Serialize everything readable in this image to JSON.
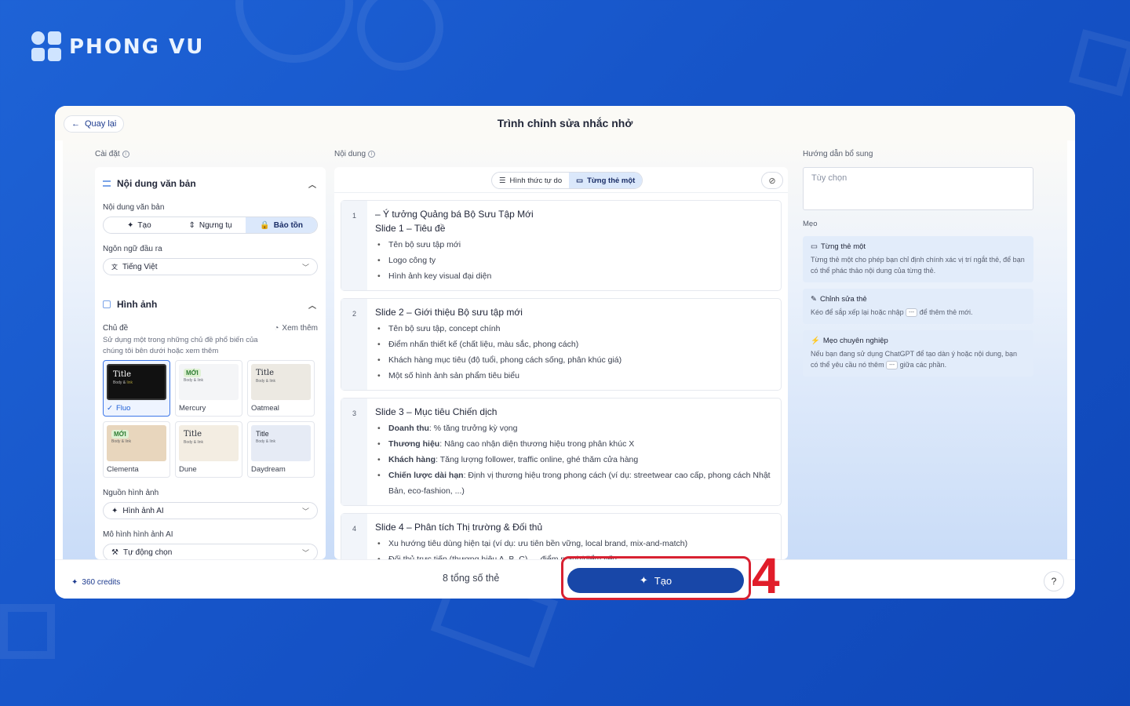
{
  "brand": {
    "name": "PHONG VU"
  },
  "window": {
    "back_label": "Quay lại",
    "title": "Trình chỉnh sửa nhắc nhở"
  },
  "settings": {
    "label": "Cài đặt",
    "text_section": {
      "title": "Nội dung văn bản",
      "content_label": "Nội dung văn bản",
      "modes": [
        "Tạo",
        "Ngưng tụ",
        "Bảo tồn"
      ],
      "active_mode": "Bảo tồn",
      "lang_label": "Ngôn ngữ đầu ra",
      "lang_value": "Tiếng Việt"
    },
    "image_section": {
      "title": "Hình ảnh",
      "theme_label": "Chủ đề",
      "theme_desc": "Sử dụng một trong những chủ đề phổ biến của chúng tôi bên dưới hoặc xem thêm",
      "see_more": "Xem thêm",
      "themes": [
        {
          "name": "Fluo",
          "preview_title": "Title",
          "selected": true,
          "badge": ""
        },
        {
          "name": "Mercury",
          "preview_title": "",
          "selected": false,
          "badge": "MỚI"
        },
        {
          "name": "Oatmeal",
          "preview_title": "Title",
          "selected": false,
          "badge": ""
        },
        {
          "name": "Clementa",
          "preview_title": "",
          "selected": false,
          "badge": "MỚI"
        },
        {
          "name": "Dune",
          "preview_title": "Title",
          "selected": false,
          "badge": ""
        },
        {
          "name": "Daydream",
          "preview_title": "Title",
          "selected": false,
          "badge": ""
        }
      ],
      "source_label": "Nguồn hình ảnh",
      "source_value": "Hình ảnh AI",
      "model_label": "Mô hình hình ảnh AI",
      "model_value": "Tự động chọn"
    }
  },
  "content": {
    "label": "Nội dung",
    "view_free": "Hình thức tự do",
    "view_card": "Từng thẻ một",
    "slides": [
      {
        "num": "1",
        "pre": "– Ý tưởng Quảng bá Bộ Sưu Tập Mới",
        "title": "Slide 1 – Tiêu đề",
        "items": [
          {
            "b": "",
            "t": "Tên bộ sưu tập mới"
          },
          {
            "b": "",
            "t": "Logo công ty"
          },
          {
            "b": "",
            "t": "Hình ảnh key visual đại diện"
          }
        ]
      },
      {
        "num": "2",
        "pre": "",
        "title": "Slide 2 – Giới thiệu Bộ sưu tập mới",
        "items": [
          {
            "b": "",
            "t": "Tên bộ sưu tập, concept chính"
          },
          {
            "b": "",
            "t": "Điểm nhấn thiết kế (chất liệu, màu sắc, phong cách)"
          },
          {
            "b": "",
            "t": "Khách hàng mục tiêu (độ tuổi, phong cách sống, phân khúc giá)"
          },
          {
            "b": "",
            "t": "Một số hình ảnh sản phẩm tiêu biểu"
          }
        ]
      },
      {
        "num": "3",
        "pre": "",
        "title": "Slide 3 – Mục tiêu Chiến dịch",
        "items": [
          {
            "b": "Doanh thu",
            "t": ": % tăng trưởng kỳ vọng"
          },
          {
            "b": "Thương hiệu",
            "t": ": Nâng cao nhận diện thương hiệu trong phân khúc X"
          },
          {
            "b": "Khách hàng",
            "t": ": Tăng lượng follower, traffic online, ghé thăm cửa hàng"
          },
          {
            "b": "Chiến lược dài hạn",
            "t": ": Định vị thương hiệu trong phong cách (ví dụ: streetwear cao cấp, phong cách Nhật Bản, eco-fashion, ...)"
          }
        ]
      },
      {
        "num": "4",
        "pre": "",
        "title": "Slide 4 – Phân tích Thị trường & Đối thủ",
        "items": [
          {
            "b": "",
            "t": "Xu hướng tiêu dùng hiện tại (ví dụ: ưu tiên bền vững, local brand, mix-and-match)"
          },
          {
            "b": "",
            "t": "Đối thủ trực tiếp (thương hiệu A, B, C) → điểm mạnh/điểm yếu"
          }
        ]
      }
    ]
  },
  "extra": {
    "label": "Hướng dẫn bổ sung",
    "placeholder": "Tùy chọn",
    "tips_label": "Mẹo",
    "tips": [
      {
        "title": "Từng thẻ một",
        "desc": "Từng thẻ một cho phép bạn chỉ định chính xác vị trí ngắt thẻ, để bạn có thể phác thảo nội dung của từng thẻ."
      },
      {
        "title": "Chỉnh sửa thẻ",
        "desc_a": "Kéo để sắp xếp lại hoặc nhập",
        "kbd": "---",
        "desc_b": "để thêm thẻ mới."
      },
      {
        "title": "Mẹo chuyên nghiệp",
        "desc_a": "Nếu bạn đang sử dụng ChatGPT để tạo dàn ý hoặc nội dung, bạn có thể yêu cầu nó thêm",
        "kbd": "---",
        "desc_b": "giữa các phần."
      }
    ]
  },
  "footer": {
    "credits": "360 credits",
    "total": "8 tổng số thẻ",
    "generate": "Tạo",
    "help": "?"
  },
  "annotation": {
    "step": "4",
    "color": "#e11d2a"
  }
}
